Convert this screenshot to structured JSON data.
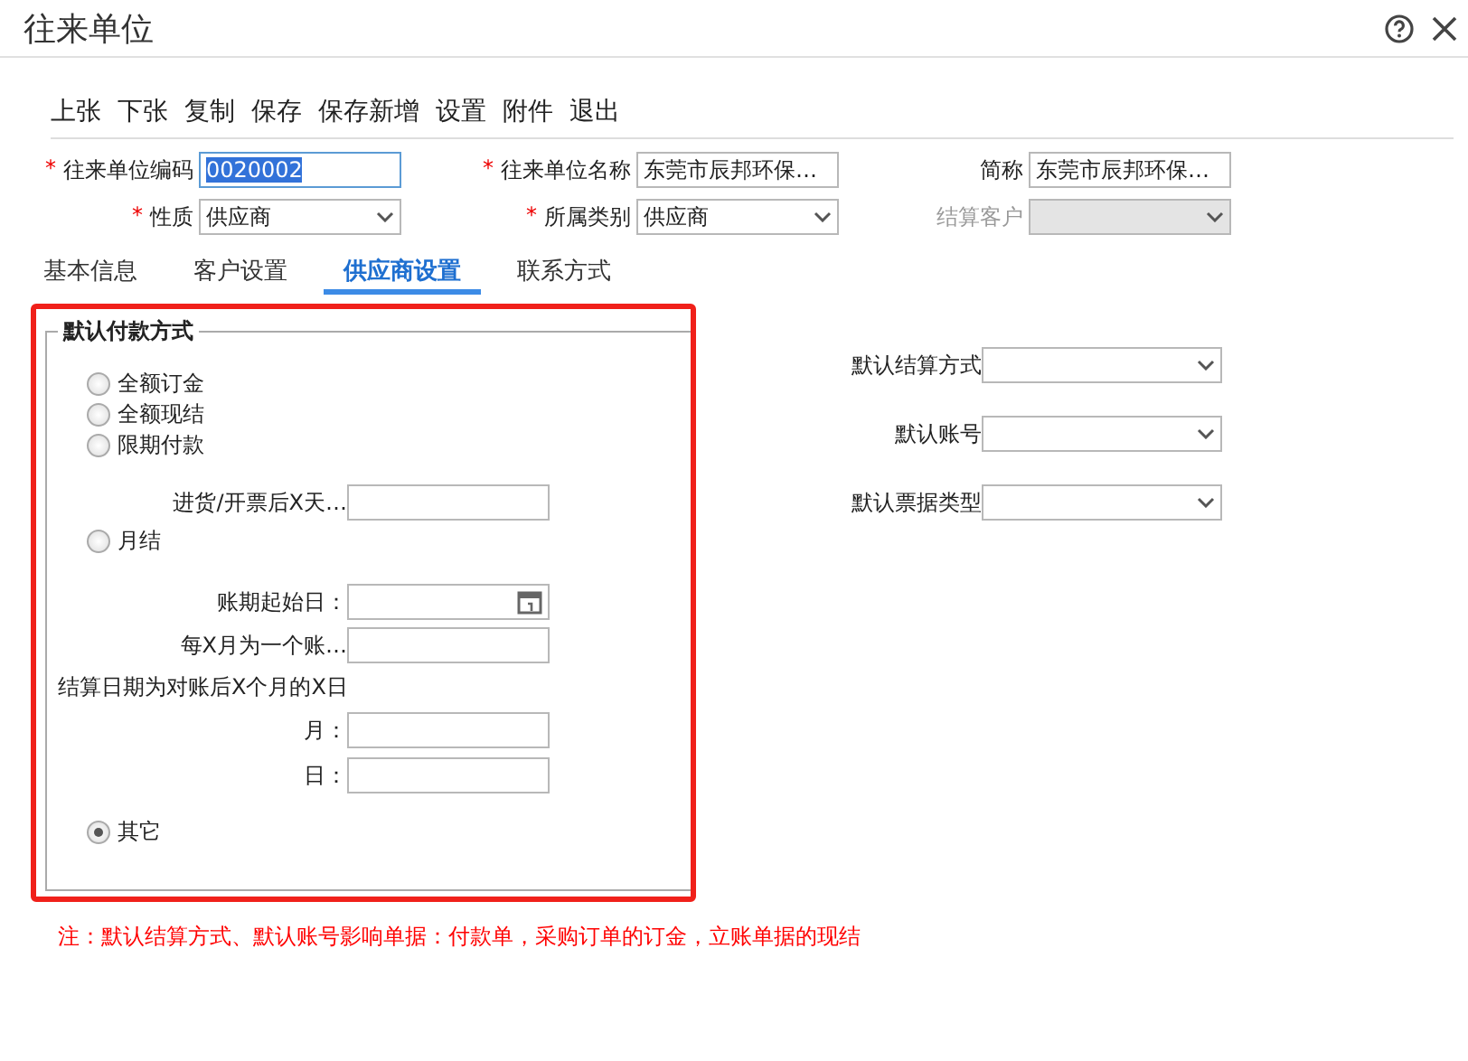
{
  "window": {
    "title": "往来单位"
  },
  "toolbar": [
    "上张",
    "下张",
    "复制",
    "保存",
    "保存新增",
    "设置",
    "附件",
    "退出"
  ],
  "header_rows": [
    {
      "fields": [
        {
          "label": "往来单位编码",
          "required_mark": "*",
          "kind": "text",
          "value": "0020002",
          "highlighted": true,
          "disabled": false
        },
        {
          "label": "往来单位名称",
          "required_mark": "*",
          "kind": "text",
          "value": "东莞市辰邦环保…",
          "highlighted": false,
          "disabled": false
        },
        {
          "label": "简称",
          "kind": "text",
          "value": "东莞市辰邦环保…",
          "highlighted": false,
          "disabled": false
        }
      ]
    },
    {
      "fields": [
        {
          "label": "性质",
          "required_mark": "*",
          "kind": "select",
          "value": "供应商",
          "highlighted": false,
          "disabled": false
        },
        {
          "label": "所属类别",
          "required_mark": "*",
          "kind": "select",
          "value": "供应商",
          "highlighted": false,
          "disabled": false
        },
        {
          "label": "结算客户",
          "kind": "select",
          "highlighted": false,
          "disabled": true
        }
      ]
    }
  ],
  "tabs": [
    {
      "label": "基本信息",
      "selected": false
    },
    {
      "label": "客户设置",
      "selected": false
    },
    {
      "label": "供应商设置",
      "selected": true
    },
    {
      "label": "联系方式",
      "selected": false
    }
  ],
  "payment_group": {
    "legend": "默认付款方式",
    "items": [
      {
        "kind": "radio",
        "label": "全额订金",
        "selected": false
      },
      {
        "kind": "radio",
        "label": "全额现结",
        "selected": false
      },
      {
        "kind": "radio",
        "label": "限期付款",
        "selected": false
      },
      {
        "kind": "field",
        "label": "进货/开票后X天…"
      },
      {
        "kind": "radio",
        "label": "月结",
        "selected": false
      },
      {
        "kind": "date",
        "label": "账期起始日："
      },
      {
        "kind": "field",
        "label": "每X月为一个账…"
      },
      {
        "kind": "heading",
        "label": "结算日期为对账后X个月的X日"
      },
      {
        "kind": "field",
        "label": "月："
      },
      {
        "kind": "field",
        "label": "日："
      },
      {
        "kind": "radio",
        "label": "其它",
        "selected": true
      }
    ]
  },
  "right_fields": [
    {
      "label": "默认结算方式"
    },
    {
      "label": "默认账号"
    },
    {
      "label": "默认票据类型"
    }
  ],
  "note": "注：默认结算方式、默认账号影响单据：付款单，采购订单的订金，立账单据的现结"
}
